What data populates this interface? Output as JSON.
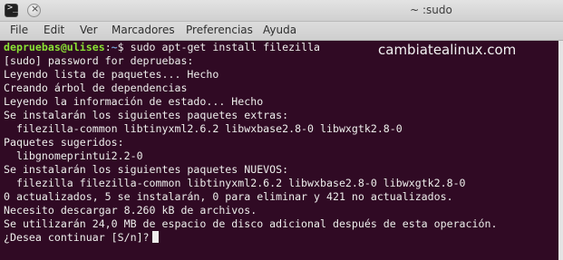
{
  "window": {
    "title": "~ :sudo",
    "icon": "terminal-icon",
    "close": "×",
    "terminal_glyph": ">_"
  },
  "menu": [
    "File",
    "Edit",
    "Ver",
    "Marcadores",
    "Preferencias",
    "Ayuda"
  ],
  "terminal": {
    "prompt_user": "depruebas@ulises",
    "prompt_sep": ":",
    "prompt_path": "~",
    "prompt_end": "$",
    "command": " sudo apt-get install filezilla",
    "lines": [
      "[sudo] password for depruebas:",
      "Leyendo lista de paquetes... Hecho",
      "Creando árbol de dependencias",
      "Leyendo la información de estado... Hecho",
      "Se instalarán los siguientes paquetes extras:",
      "  filezilla-common libtinyxml2.6.2 libwxbase2.8-0 libwxgtk2.8-0",
      "Paquetes sugeridos:",
      "  libgnomeprintui2.2-0",
      "Se instalarán los siguientes paquetes NUEVOS:",
      "  filezilla filezilla-common libtinyxml2.6.2 libwxbase2.8-0 libwxgtk2.8-0",
      "0 actualizados, 5 se instalarán, 0 para eliminar y 421 no actualizados.",
      "Necesito descargar 8.260 kB de archivos.",
      "Se utilizarán 24,0 MB de espacio de disco adicional después de esta operación.",
      "¿Desea continuar [S/n]?"
    ]
  },
  "watermark": "cambiatealinux.com",
  "colors": {
    "background": "#300a24",
    "text": "#eeeeec",
    "user": "#8ae234",
    "path": "#729fcf"
  }
}
